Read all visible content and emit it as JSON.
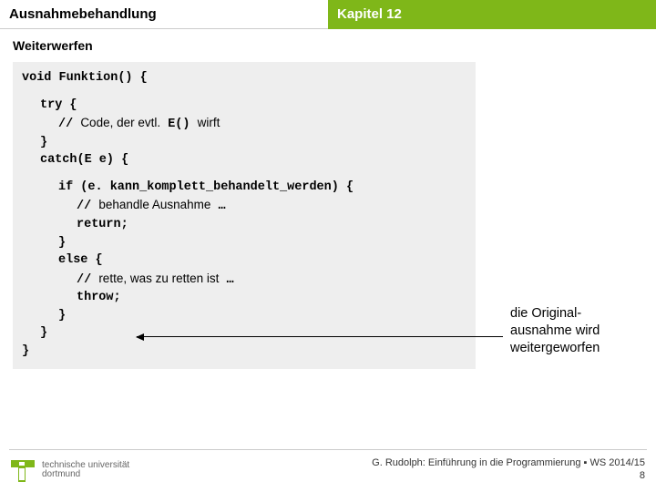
{
  "header": {
    "left": "Ausnahmebehandlung",
    "right": "Kapitel 12"
  },
  "subtitle": "Weiterwerfen",
  "code": {
    "l1": "void Funktion() {",
    "l2": "try {",
    "l3a": "// ",
    "l3b": "Code, der evtl.",
    "l3c": " E() ",
    "l3d": "wirft",
    "l4": "}",
    "l5": "catch(E e) {",
    "l6": "if (e. kann_komplett_behandelt_werden) {",
    "l7a": "// ",
    "l7b": "behandle Ausnahme",
    "l7c": " …",
    "l8": "return;",
    "l9": "}",
    "l10": "else {",
    "l11a": "// ",
    "l11b": "rette, was zu retten ist",
    "l11c": " …",
    "l12": "throw;",
    "l13": "}",
    "l14": "}",
    "l15": "}"
  },
  "annotation": {
    "line1": "die Original-",
    "line2": "ausnahme wird",
    "line3": "weitergeworfen"
  },
  "footer": {
    "uni1": "technische universität",
    "uni2": "dortmund",
    "credit": "G. Rudolph: Einführung in die Programmierung ▪ WS 2014/15",
    "page": "8"
  }
}
